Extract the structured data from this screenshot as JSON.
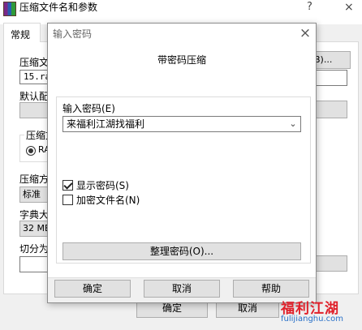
{
  "parent_dialog": {
    "title": "压缩文件名和参数",
    "help_glyph": "?",
    "close_glyph": "×",
    "tabs": [
      {
        "label": "常规"
      }
    ],
    "archive_label": "压缩文",
    "archive_value": "15.ra",
    "browse_fragment": "B)...",
    "default_label": "默认配",
    "format_label": "压缩文",
    "format_option": "RA",
    "method_label": "压缩方",
    "method_value": "标准",
    "dict_label": "字典大",
    "dict_value": "32 MB",
    "split_label": "切分为",
    "ok_label": "确定",
    "cancel_label": "取消"
  },
  "password_dialog": {
    "title": "输入密码",
    "close_glyph": "×",
    "heading": "带密码压缩",
    "enter_password_label": "输入密码(E)",
    "password_value": "来福利江湖找福利",
    "dropdown_glyph": "⌄",
    "show_password": {
      "label": "显示密码(S)",
      "checked": true
    },
    "encrypt_filenames": {
      "label": "加密文件名(N)",
      "checked": false
    },
    "organize_button": "整理密码(O)...",
    "buttons": {
      "ok": "确定",
      "cancel": "取消",
      "help": "帮助"
    }
  },
  "watermark": {
    "logo_text": "福利江湖",
    "url": "fulijianghu.com",
    "color": "#e0202a"
  }
}
